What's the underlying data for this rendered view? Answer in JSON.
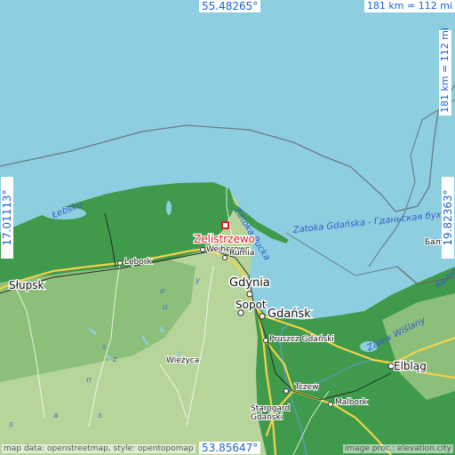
{
  "map": {
    "colors": {
      "sea": "#8dcfe0",
      "lowland": "#3f9a4c",
      "hills": "#8cc07a",
      "upland": "#b7d59a",
      "roads": "#f3d24a",
      "border": "#666666",
      "highlight": "#e02020"
    },
    "highlight": {
      "name": "Zelistrzewo",
      "marker": "red-square"
    },
    "cities": [
      {
        "id": "slupsk",
        "name": "Słupsk"
      },
      {
        "id": "lebork",
        "name": "Lębork"
      },
      {
        "id": "wejherowo",
        "name": "Wejherowo"
      },
      {
        "id": "rumia",
        "name": "Rumia"
      },
      {
        "id": "gdynia",
        "name": "Gdynia"
      },
      {
        "id": "sopot",
        "name": "Sopot"
      },
      {
        "id": "gdansk",
        "name": "Gdańsk"
      },
      {
        "id": "pruszcz",
        "name": "Pruszcz Gdański"
      },
      {
        "id": "elblag",
        "name": "Elbląg"
      },
      {
        "id": "tczew",
        "name": "Tczew"
      },
      {
        "id": "malbork",
        "name": "Malbork"
      },
      {
        "id": "starogard",
        "name": "Starogard\nGdański"
      },
      {
        "id": "wiezyca",
        "name": "Wieżyca"
      },
      {
        "id": "balt",
        "name": "Балт"
      }
    ],
    "water_labels": [
      {
        "id": "lebsko",
        "name": "Łebsko"
      },
      {
        "id": "zatoka-pucka",
        "name": "Zatoka Pucka"
      },
      {
        "id": "zatoka-gdanska",
        "name": "Zatoka Gdańska - Гданьская бух"
      },
      {
        "id": "zalew-wislany",
        "name": "Zalew Wiślany"
      },
      {
        "id": "kalin",
        "name": "Калин"
      }
    ],
    "scattered_letters": [
      "y",
      "o",
      "u",
      "s",
      "z",
      "n",
      "a",
      "s",
      "s"
    ]
  },
  "frame": {
    "coord_top": "55.48265°",
    "coord_bottom": "53.85647°",
    "coord_left": "17.01113°",
    "coord_right": "19.82363°",
    "scale_top": "181 km = 112 mi",
    "scale_right": "181 km = 112 mi",
    "credits_left": "map data: openstreetmap, style: opentopomap",
    "credits_right": "image proc.: elevation.city"
  }
}
